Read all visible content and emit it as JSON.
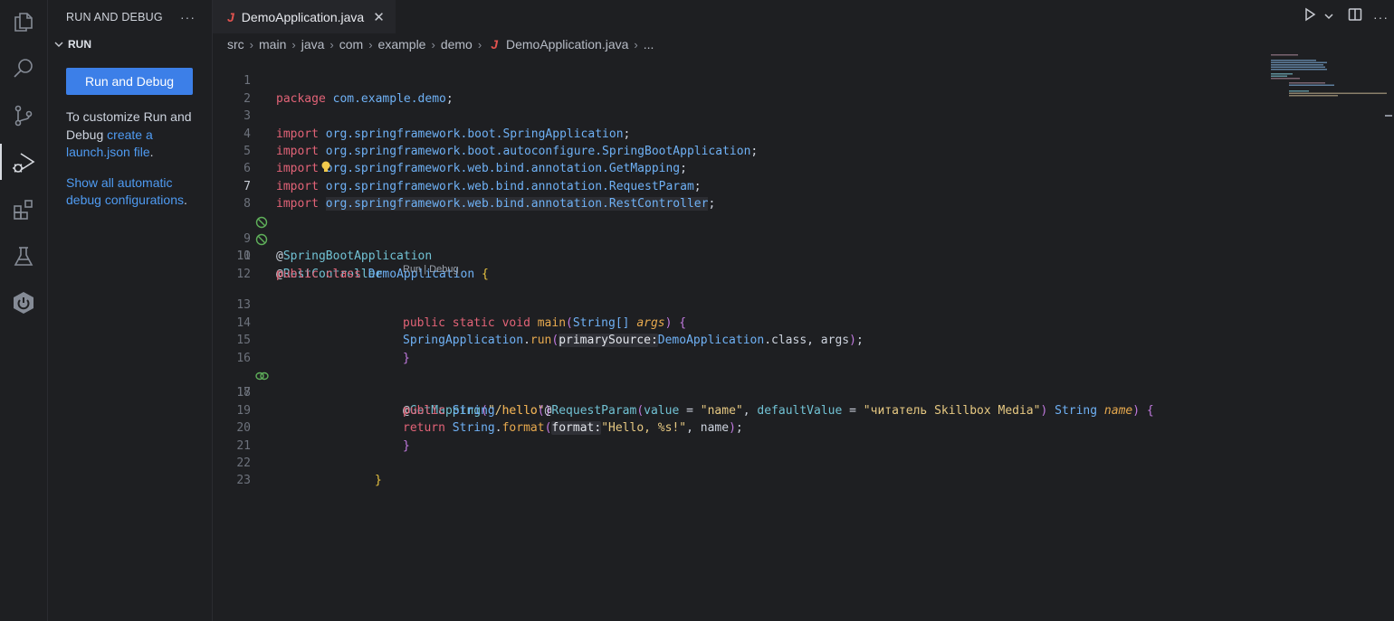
{
  "activity_bar": {
    "icons": [
      "explorer-icon",
      "search-icon",
      "source-control-icon",
      "run-debug-icon",
      "extensions-icon",
      "testing-icon",
      "spring-boot-icon"
    ]
  },
  "sidebar": {
    "title": "RUN AND DEBUG",
    "more": "···",
    "section": "RUN",
    "run_button": "Run and Debug",
    "text1_a": "To customize Run and Debug ",
    "text1_link": "create a launch.json file",
    "text1_b": ".",
    "text2_link": "Show all automatic debug configurations",
    "text2_b": "."
  },
  "tabs": [
    {
      "icon": "J",
      "label": "DemoApplication.java",
      "close": "✕"
    }
  ],
  "breadcrumb": {
    "items": [
      "src",
      "main",
      "java",
      "com",
      "example",
      "demo"
    ],
    "file_icon": "J",
    "file": "DemoApplication.java",
    "ellipsis": "..."
  },
  "codelens": "Run | Debug",
  "line_numbers": [
    "1",
    "2",
    "3",
    "4",
    "5",
    "6",
    "7",
    "8",
    "9",
    "10",
    "11",
    "12",
    "13",
    "14",
    "15",
    "16",
    "17",
    "18",
    "19",
    "20",
    "21",
    "22",
    "23"
  ],
  "code": {
    "l1": {
      "kw": "package",
      "pkg": "com.example.demo",
      "end": ";"
    },
    "l3": {
      "kw": "import",
      "pkg": "org.springframework.boot.SpringApplication",
      "end": ";"
    },
    "l4": {
      "kw": "import",
      "pkg": "org.springframework.boot.autoconfigure.SpringBootApplication",
      "end": ";"
    },
    "l5": {
      "kw": "import",
      "pkg": "org.springframework.web.bind.annotation.GetMapping",
      "end": ";"
    },
    "l6": {
      "kw": "import",
      "pkg": "org.springframework.web.bind.annotation.RequestParam",
      "end": ";"
    },
    "l7": {
      "kw": "import",
      "pkg": "org.springframework.web.bind.annotation.RestController",
      "end": ";"
    },
    "l9": {
      "at": "@",
      "ann": "SpringBootApplication"
    },
    "l10": {
      "at": "@",
      "ann": "RestController"
    },
    "l11": {
      "kw1": "public",
      "kw2": "class",
      "cls": "DemoApplication",
      "brace": "{"
    },
    "l13": {
      "kw1": "public",
      "kw2": "static",
      "kw3": "void",
      "fn": "main",
      "p1": "(",
      "type": "String[]",
      "arg": "args",
      "p2": ")",
      "brace": "{"
    },
    "l14": {
      "cls": "SpringApplication",
      "dot": ".",
      "fn": "run",
      "p1": "(",
      "hint": "primarySource:",
      "cls2": "DemoApplication",
      "rest": ".class, args",
      "p2": ")",
      "end": ";"
    },
    "l15": {
      "brace": "}"
    },
    "l17": {
      "at": "@",
      "ann": "GetMapping",
      "p1": "(",
      "str": "\"/hello\"",
      "p2": ")"
    },
    "l18": {
      "kw1": "public",
      "type": "String",
      "fn": "hello",
      "p1": "(",
      "at": "@",
      "ann": "RequestParam",
      "p2": "(",
      "a1": "value",
      "eq1": " = ",
      "s1": "\"name\"",
      "comma": ", ",
      "a2": "defaultValue",
      "eq2": " = ",
      "s2": "\"читатель Skillbox Media\"",
      "p3": ")",
      "type2": "String",
      "arg": "name",
      "p4": ")",
      "brace": "{"
    },
    "l19": {
      "kw": "return",
      "cls": "String",
      "dot": ".",
      "fn": "format",
      "p1": "(",
      "hint": "format:",
      "str": "\"Hello, %s!\"",
      "rest": ", name",
      "p2": ")",
      "end": ";"
    },
    "l20": {
      "brace": "}"
    },
    "l22": {
      "brace": "}"
    }
  },
  "colors": {
    "accent": "#3c7fe8",
    "link": "#4f9bf2",
    "keyword": "#e26377",
    "string": "#e7c982",
    "annotation": "#71c2d4",
    "gutter_icon": "#5fb05a"
  }
}
